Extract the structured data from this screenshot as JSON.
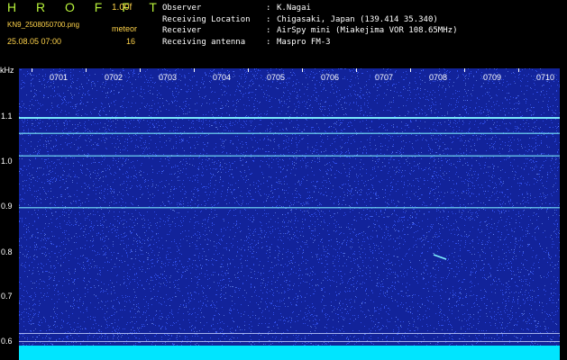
{
  "header": {
    "logo": "H R O F F T",
    "version": "1.00f",
    "filename": "KN9_2508050700.png",
    "meteor_label": "meteor",
    "datetime": "25.08.05 07:00",
    "meteor_count": "16"
  },
  "info": [
    {
      "key": "Observer",
      "value": "K.Nagai"
    },
    {
      "key": "Receiving Location",
      "value": "Chigasaki, Japan (139.414 35.340)"
    },
    {
      "key": "Receiver",
      "value": "AirSpy mini (Miakejima VOR 108.65MHz)"
    },
    {
      "key": "Receiving antenna",
      "value": "Maspro FM-3"
    }
  ],
  "spectrogram": {
    "freq_unit": "kHz",
    "freq_labels": [
      "1.1",
      "1.0",
      "0.9",
      "0.8",
      "0.7",
      "0.6"
    ],
    "time_labels": [
      "0701",
      "0702",
      "0703",
      "0704",
      "0705",
      "0706",
      "0707",
      "0708",
      "0709",
      "0710"
    ],
    "background_color": "#12239a",
    "noise_color": "#3a5cff",
    "signal_color": "#7ff2ff",
    "bottom_band_color": "#00e5ff",
    "lines_khz": [
      1.1,
      1.065,
      1.015,
      0.9
    ],
    "meteor_echo": {
      "time": "0708.3",
      "khz": 0.79
    }
  }
}
